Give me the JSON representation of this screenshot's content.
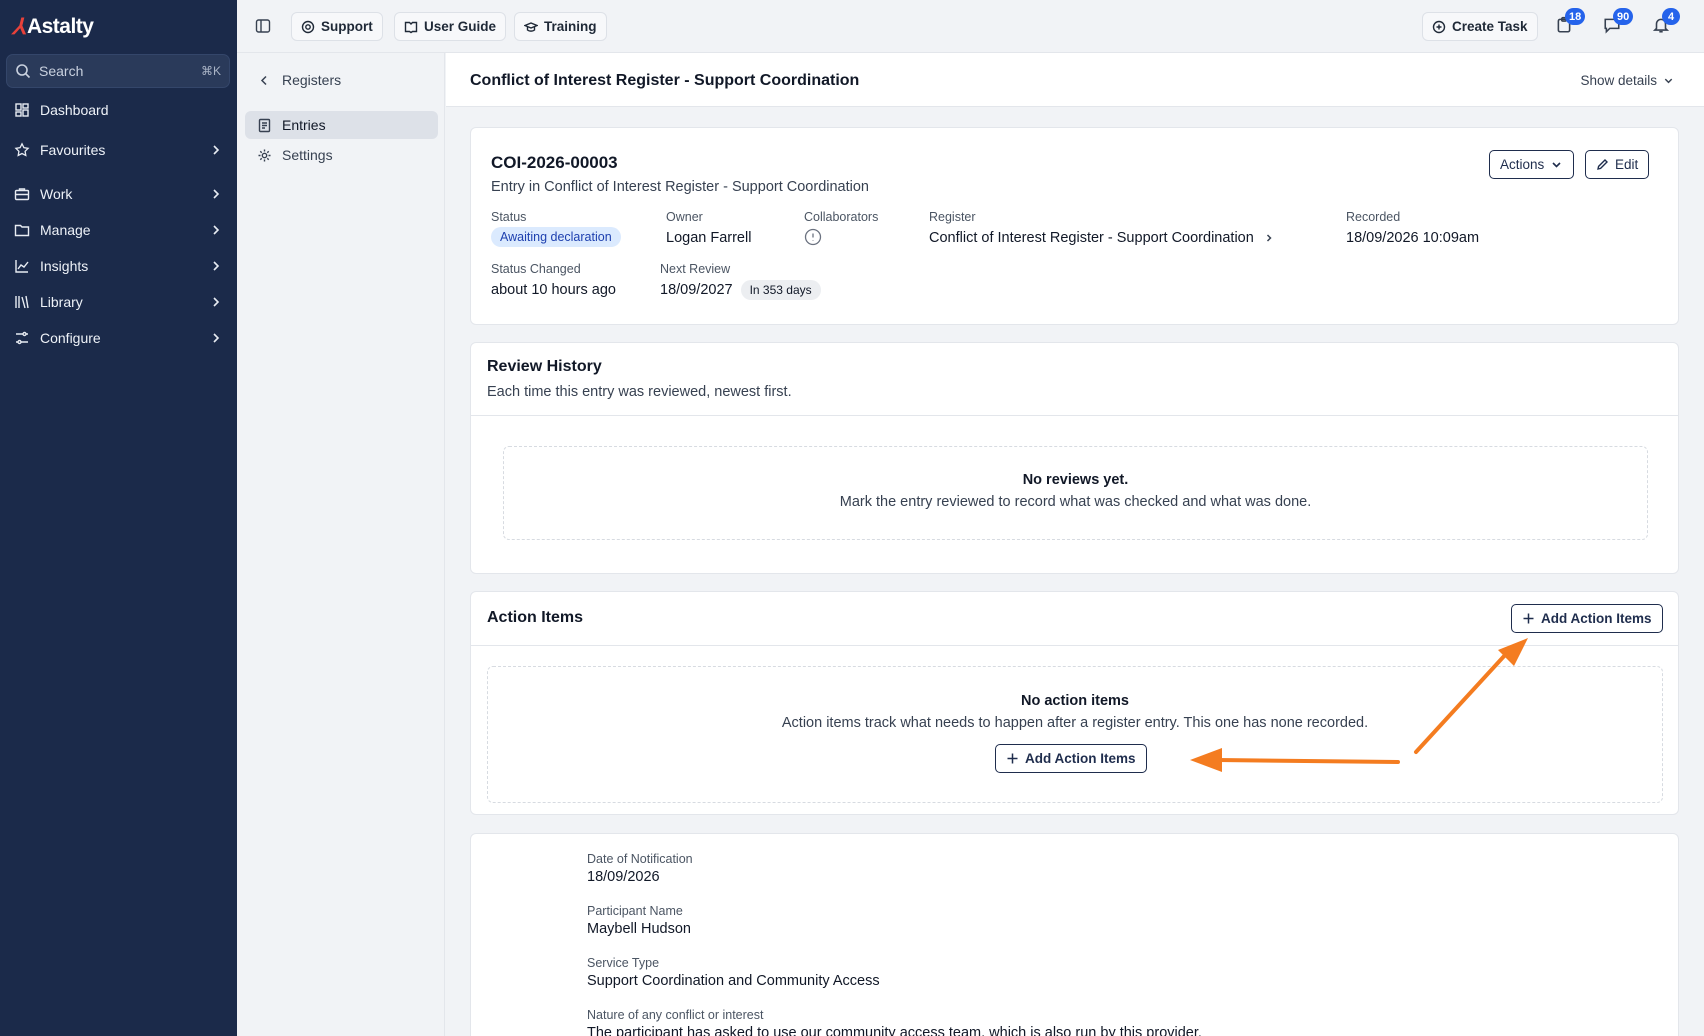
{
  "brand": {
    "logo_text": "Astalty"
  },
  "sidebar": {
    "search_label": "Search",
    "search_shortcut": "⌘K",
    "items": [
      {
        "label": "Dashboard",
        "icon": "dashboard-icon"
      },
      {
        "label": "Favourites",
        "icon": "star-icon"
      },
      {
        "label": "Work",
        "icon": "briefcase-icon"
      },
      {
        "label": "Manage",
        "icon": "folder-icon"
      },
      {
        "label": "Insights",
        "icon": "chart-icon"
      },
      {
        "label": "Library",
        "icon": "library-icon"
      },
      {
        "label": "Configure",
        "icon": "sliders-icon"
      }
    ]
  },
  "topbar": {
    "support": "Support",
    "user_guide": "User Guide",
    "training": "Training",
    "create_task": "Create Task",
    "badges": {
      "tasks": "18",
      "messages": "90",
      "notifications": "4"
    }
  },
  "subnav": {
    "back_label": "Registers",
    "entries": "Entries",
    "settings": "Settings"
  },
  "page": {
    "title": "Conflict of Interest Register - Support Coordination",
    "show_details": "Show details"
  },
  "entry": {
    "id": "COI-2026-00003",
    "subtitle": "Entry in Conflict of Interest Register - Support Coordination",
    "actions_label": "Actions",
    "edit_label": "Edit",
    "status_label": "Status",
    "status_value": "Awaiting declaration",
    "owner_label": "Owner",
    "owner_value": "Logan Farrell",
    "collaborators_label": "Collaborators",
    "register_label": "Register",
    "register_value": "Conflict of Interest Register - Support Coordination",
    "recorded_label": "Recorded",
    "recorded_value": "18/09/2026 10:09am",
    "status_changed_label": "Status Changed",
    "status_changed_value": "about 10 hours ago",
    "next_review_label": "Next Review",
    "next_review_value": "18/09/2027",
    "next_review_pill": "In 353 days"
  },
  "review_history": {
    "title": "Review History",
    "subtitle": "Each time this entry was reviewed, newest first.",
    "empty_title": "No reviews yet.",
    "empty_desc": "Mark the entry reviewed to record what was checked and what was done."
  },
  "action_items": {
    "title": "Action Items",
    "add_label": "Add Action Items",
    "empty_title": "No action items",
    "empty_desc": "Action items track what needs to happen after a register entry. This one has none recorded.",
    "add_label_center": "Add Action Items"
  },
  "details": {
    "date_label": "Date of Notification",
    "date_value": "18/09/2026",
    "participant_label": "Participant Name",
    "participant_value": "Maybell Hudson",
    "service_label": "Service Type",
    "service_value": "Support Coordination and Community Access",
    "nature_label": "Nature of any conflict or interest",
    "nature_value": "The participant has asked to use our community access team, which is also run by this provider."
  },
  "colors": {
    "sidebar_bg": "#1b2a4a",
    "accent": "#2563eb",
    "annotation_arrow": "#f47c20",
    "status_pill": "#dbeafe"
  }
}
